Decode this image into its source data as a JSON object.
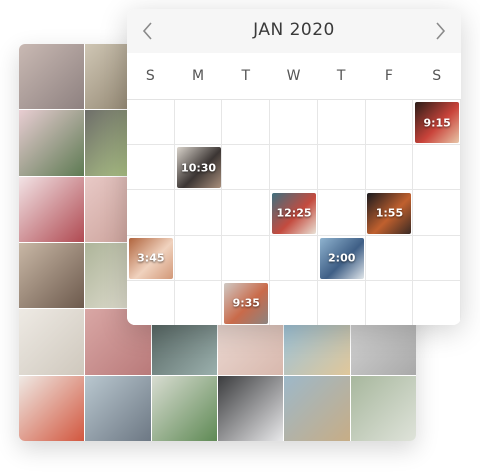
{
  "calendar": {
    "title": "JAN 2020",
    "prev_icon": "chevron-left-icon",
    "next_icon": "chevron-right-icon",
    "weekdays": [
      "S",
      "M",
      "T",
      "W",
      "T",
      "F",
      "S"
    ],
    "scheduled_posts": [
      {
        "time": "9:15",
        "row": 0,
        "col": 6,
        "colors": [
          "#2b1d18",
          "#c9433a",
          "#e8c6a8"
        ]
      },
      {
        "time": "10:30",
        "row": 1,
        "col": 1,
        "colors": [
          "#d9d3cb",
          "#3b3533",
          "#a98f7c"
        ]
      },
      {
        "time": "12:25",
        "row": 2,
        "col": 3,
        "colors": [
          "#3f6f7e",
          "#c44b3f",
          "#e9e2d6"
        ]
      },
      {
        "time": "1:55",
        "row": 2,
        "col": 5,
        "colors": [
          "#1a1a1e",
          "#c0602e",
          "#3a2a24"
        ]
      },
      {
        "time": "3:45",
        "row": 3,
        "col": 0,
        "colors": [
          "#b0643d",
          "#f0d2be",
          "#d29878"
        ]
      },
      {
        "time": "2:00",
        "row": 3,
        "col": 4,
        "colors": [
          "#8fb3cf",
          "#3f5f86",
          "#e0e6ea"
        ]
      },
      {
        "time": "9:35",
        "row": 4,
        "col": 2,
        "colors": [
          "#cfc9c4",
          "#c96a4a",
          "#8c8480"
        ]
      }
    ]
  },
  "photo_grid": {
    "tiles": [
      {
        "name": "city-skyline-photo",
        "colors": [
          "#c9b9b3",
          "#8e8180"
        ],
        "icon": ""
      },
      {
        "name": "plant-shelf-photo",
        "colors": [
          "#cfc6b4",
          "#8b7f6a"
        ],
        "icon": ""
      },
      {
        "name": "photo-hidden-1",
        "colors": [
          "#ddd",
          "#ccc"
        ],
        "icon": ""
      },
      {
        "name": "photo-hidden-2",
        "colors": [
          "#ddd",
          "#ccc"
        ],
        "icon": ""
      },
      {
        "name": "photo-hidden-3",
        "colors": [
          "#ddd",
          "#ccc"
        ],
        "icon": ""
      },
      {
        "name": "photo-hidden-4",
        "colors": [
          "#ddd",
          "#ccc"
        ],
        "icon": ""
      },
      {
        "name": "cactus-photo",
        "colors": [
          "#e8cdd2",
          "#5d7a52"
        ],
        "icon": ""
      },
      {
        "name": "matcha-drink-photo",
        "colors": [
          "#6e6e6a",
          "#b8d28a"
        ],
        "icon": ""
      },
      {
        "name": "photo-hidden-5",
        "colors": [
          "#ddd",
          "#ccc"
        ],
        "icon": ""
      },
      {
        "name": "photo-hidden-6",
        "colors": [
          "#ddd",
          "#ccc"
        ],
        "icon": ""
      },
      {
        "name": "photo-hidden-7",
        "colors": [
          "#ddd",
          "#ccc"
        ],
        "icon": ""
      },
      {
        "name": "photo-hidden-8",
        "colors": [
          "#ddd",
          "#ccc"
        ],
        "icon": ""
      },
      {
        "name": "berry-cake-photo",
        "colors": [
          "#f2e3e5",
          "#b04a52"
        ],
        "icon": ""
      },
      {
        "name": "pink-interior-photo",
        "colors": [
          "#e8c9c6",
          "#c79c94"
        ],
        "icon": ""
      },
      {
        "name": "photo-hidden-9",
        "colors": [
          "#ddd",
          "#ccc"
        ],
        "icon": ""
      },
      {
        "name": "photo-hidden-10",
        "colors": [
          "#ddd",
          "#ccc"
        ],
        "icon": ""
      },
      {
        "name": "photo-hidden-11",
        "colors": [
          "#ddd",
          "#ccc"
        ],
        "icon": ""
      },
      {
        "name": "photo-hidden-12",
        "colors": [
          "#ddd",
          "#ccc"
        ],
        "icon": ""
      },
      {
        "name": "woman-portrait-photo",
        "colors": [
          "#c8b7a5",
          "#6d5a4d"
        ],
        "icon": ""
      },
      {
        "name": "flowers-vase-photo",
        "colors": [
          "#aeb59a",
          "#e6e2d6"
        ],
        "icon": ""
      },
      {
        "name": "photo-hidden-13",
        "colors": [
          "#ddd",
          "#ccc"
        ],
        "icon": ""
      },
      {
        "name": "photo-hidden-14",
        "colors": [
          "#ddd",
          "#ccc"
        ],
        "icon": ""
      },
      {
        "name": "photo-hidden-15",
        "colors": [
          "#ddd",
          "#ccc"
        ],
        "icon": ""
      },
      {
        "name": "photo-hidden-16",
        "colors": [
          "#ddd",
          "#ccc"
        ],
        "icon": ""
      },
      {
        "name": "white-outfit-photo",
        "colors": [
          "#eeeae4",
          "#cfc8bd"
        ],
        "icon": ""
      },
      {
        "name": "pink-building-photo",
        "colors": [
          "#d9a7a5",
          "#b97a7a"
        ],
        "icon": ""
      },
      {
        "name": "pool-palms-photo",
        "colors": [
          "#4f5e5b",
          "#9bb0ad"
        ],
        "icon": ""
      },
      {
        "name": "coffee-cup-photo",
        "colors": [
          "#eddcd6",
          "#d8b8ad"
        ],
        "icon": ""
      },
      {
        "name": "woman-sunshine-photo",
        "colors": [
          "#94c2e0",
          "#e0c79a"
        ],
        "icon": ""
      },
      {
        "name": "architecture-curve-photo",
        "colors": [
          "#d7d7d7",
          "#a9a9a9"
        ],
        "icon": ""
      },
      {
        "name": "flower-bouquet-photo",
        "colors": [
          "#efe9e4",
          "#d2573f"
        ],
        "icon": ""
      },
      {
        "name": "couple-street-photo",
        "colors": [
          "#b9c7cf",
          "#6d7884"
        ],
        "icon": ""
      },
      {
        "name": "monstera-leaves-photo",
        "colors": [
          "#d8dcd1",
          "#5f8a55"
        ],
        "icon": ""
      },
      {
        "name": "orchids-photo",
        "colors": [
          "#3b3c3e",
          "#e8e8ea"
        ],
        "icon": ""
      },
      {
        "name": "city-lake-photo",
        "colors": [
          "#9db8c9",
          "#c7ad86"
        ],
        "icon": ""
      },
      {
        "name": "tropical-plants-photo",
        "colors": [
          "#a7b79d",
          "#dfe3da"
        ],
        "icon": ""
      }
    ]
  }
}
